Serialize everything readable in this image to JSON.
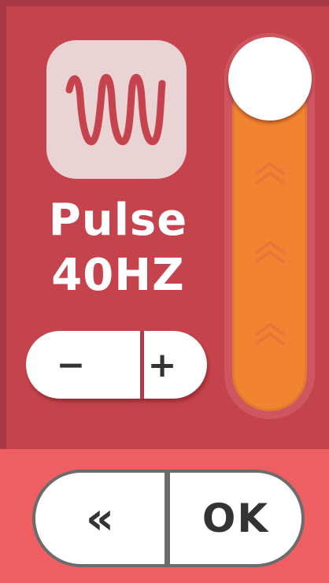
{
  "mode": {
    "icon": "sine-wave-icon",
    "name": "Pulse",
    "frequency": "40HZ"
  },
  "stepper": {
    "minus_label": "−",
    "plus_label": "+"
  },
  "intensity_slider": {
    "level": 1.0,
    "chevron_icon": "double-chevron-up-icon"
  },
  "actions": {
    "back_label": "«",
    "ok_label": "OK"
  },
  "colors": {
    "background": "#c4434d",
    "bottom_bar": "#ef5f62",
    "slider_fill": "#f08430",
    "icon_tile": "#ead3d5",
    "wave_stroke": "#c4434d"
  }
}
